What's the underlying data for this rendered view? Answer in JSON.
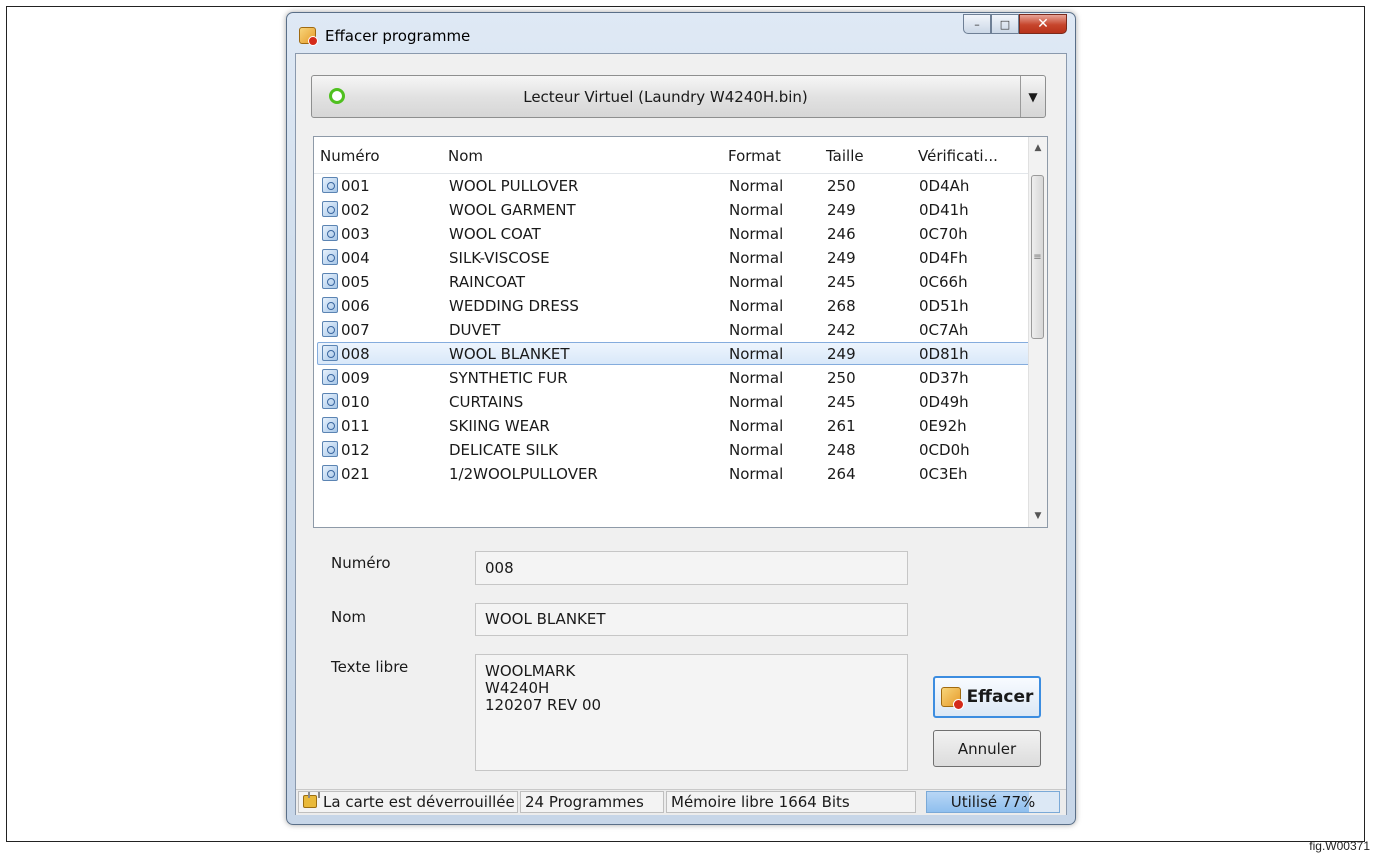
{
  "window": {
    "title": "Effacer programme"
  },
  "device": {
    "label": "Lecteur Virtuel (Laundry W4240H.bin)",
    "status_color": "#4fc01f"
  },
  "list": {
    "columns": [
      "Numéro",
      "Nom",
      "Format",
      "Taille",
      "Vérificati..."
    ],
    "rows": [
      {
        "num": "001",
        "name": "WOOL PULLOVER",
        "format": "Normal",
        "size": "250",
        "check": "0D4Ah"
      },
      {
        "num": "002",
        "name": "WOOL GARMENT",
        "format": "Normal",
        "size": "249",
        "check": "0D41h"
      },
      {
        "num": "003",
        "name": "WOOL COAT",
        "format": "Normal",
        "size": "246",
        "check": "0C70h"
      },
      {
        "num": "004",
        "name": "SILK-VISCOSE",
        "format": "Normal",
        "size": "249",
        "check": "0D4Fh"
      },
      {
        "num": "005",
        "name": "RAINCOAT",
        "format": "Normal",
        "size": "245",
        "check": "0C66h"
      },
      {
        "num": "006",
        "name": "WEDDING DRESS",
        "format": "Normal",
        "size": "268",
        "check": "0D51h"
      },
      {
        "num": "007",
        "name": "DUVET",
        "format": "Normal",
        "size": "242",
        "check": "0C7Ah"
      },
      {
        "num": "008",
        "name": "WOOL BLANKET",
        "format": "Normal",
        "size": "249",
        "check": "0D81h"
      },
      {
        "num": "009",
        "name": "SYNTHETIC FUR",
        "format": "Normal",
        "size": "250",
        "check": "0D37h"
      },
      {
        "num": "010",
        "name": "CURTAINS",
        "format": "Normal",
        "size": "245",
        "check": "0D49h"
      },
      {
        "num": "011",
        "name": "SKIING WEAR",
        "format": "Normal",
        "size": "261",
        "check": "0E92h"
      },
      {
        "num": "012",
        "name": "DELICATE SILK",
        "format": "Normal",
        "size": "248",
        "check": "0CD0h"
      },
      {
        "num": "021",
        "name": "1/2WOOLPULLOVER",
        "format": "Normal",
        "size": "264",
        "check": "0C3Eh"
      }
    ],
    "selected_index": 7
  },
  "details": {
    "number_label": "Numéro",
    "number_value": "008",
    "name_label": "Nom",
    "name_value": "WOOL BLANKET",
    "notes_label": "Texte libre",
    "notes_value": "WOOLMARK\nW4240H\n120207 REV 00"
  },
  "buttons": {
    "erase": "Effacer",
    "cancel": "Annuler"
  },
  "status": {
    "lock": "La carte est déverrouillée",
    "programs": "24 Programmes",
    "free_memory": "Mémoire libre 1664 Bits",
    "used": "Utilisé 77%",
    "used_fraction": 0.77
  },
  "figure_label": "fig.W00371"
}
